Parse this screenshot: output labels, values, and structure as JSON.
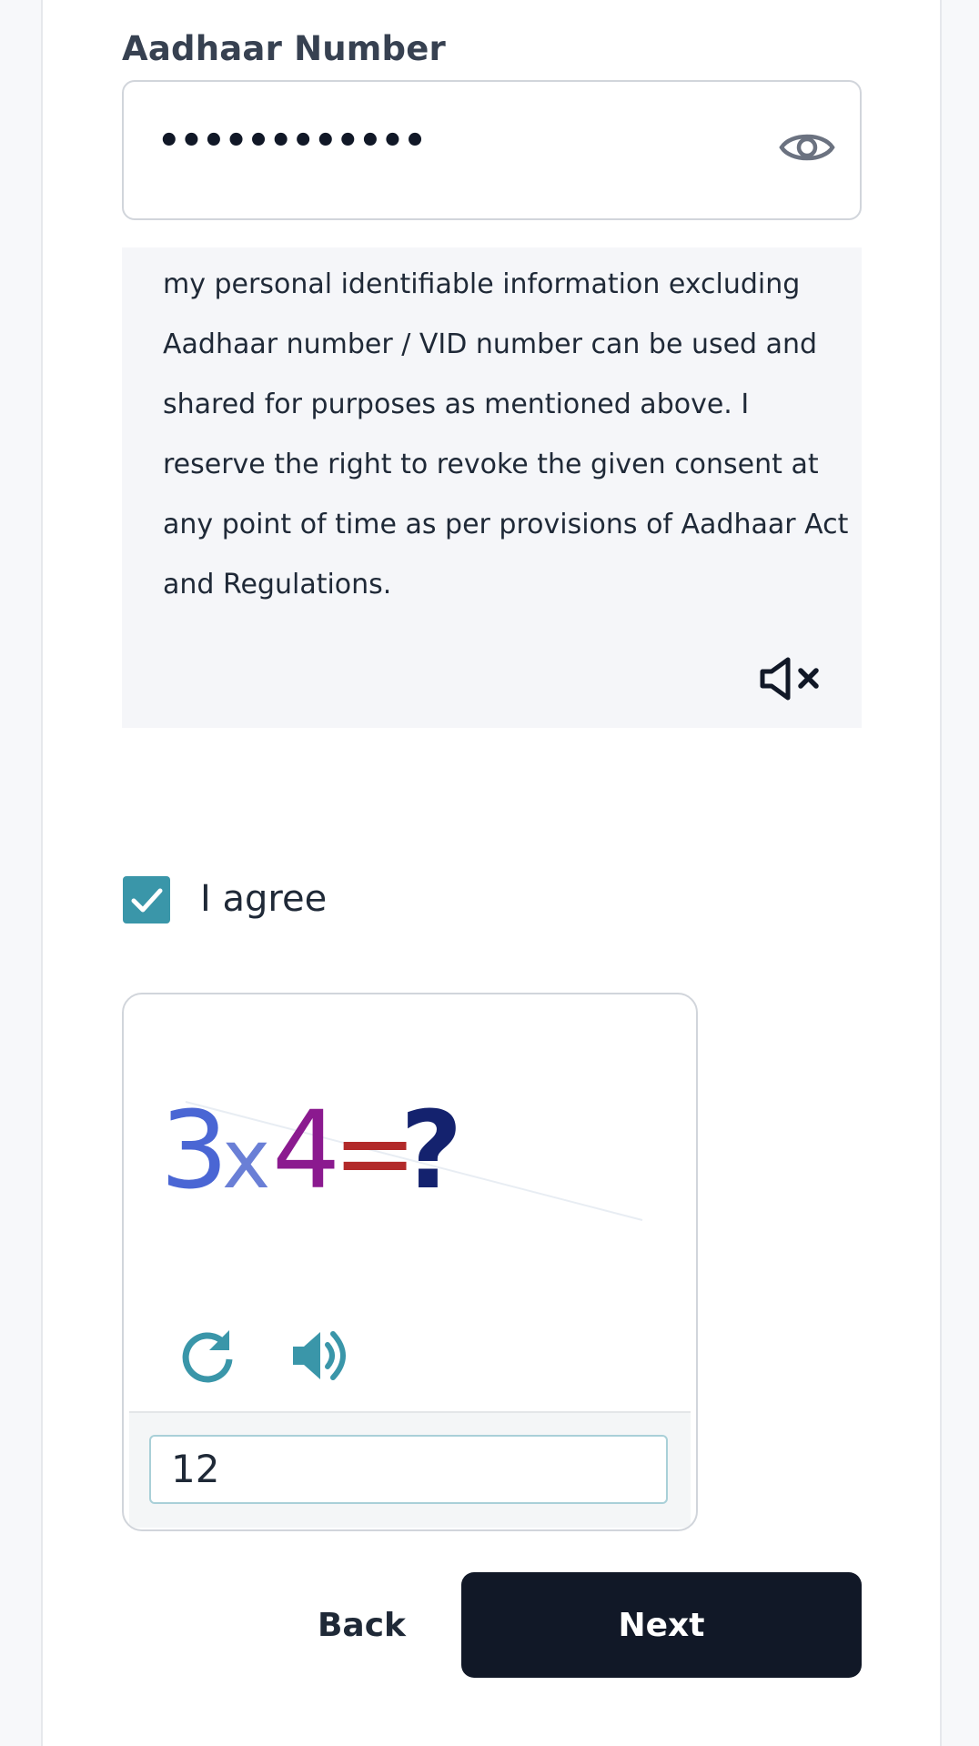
{
  "aadhaar": {
    "label": "Aadhaar Number",
    "value": "••••••••••••",
    "toggle_icon": "eye-icon"
  },
  "consent": {
    "lines": [
      "my personal identifiable information excluding",
      "Aadhaar number / VID number can be used and",
      "shared for purposes as mentioned above. I",
      "reserve the right to revoke the given consent at",
      "any point of time as per provisions of Aadhaar Act",
      "and Regulations."
    ],
    "audio_icon": "speaker-mute-icon"
  },
  "agree": {
    "label": "I agree",
    "checked": true
  },
  "captcha": {
    "expression": [
      "3",
      "x",
      "4",
      "=",
      "?"
    ],
    "refresh_icon": "refresh-icon",
    "audio_icon": "speaker-icon",
    "answer": "12"
  },
  "actions": {
    "back_label": "Back",
    "next_label": "Next"
  },
  "colors": {
    "accent": "#3a96a9",
    "primary_button": "#111827"
  }
}
